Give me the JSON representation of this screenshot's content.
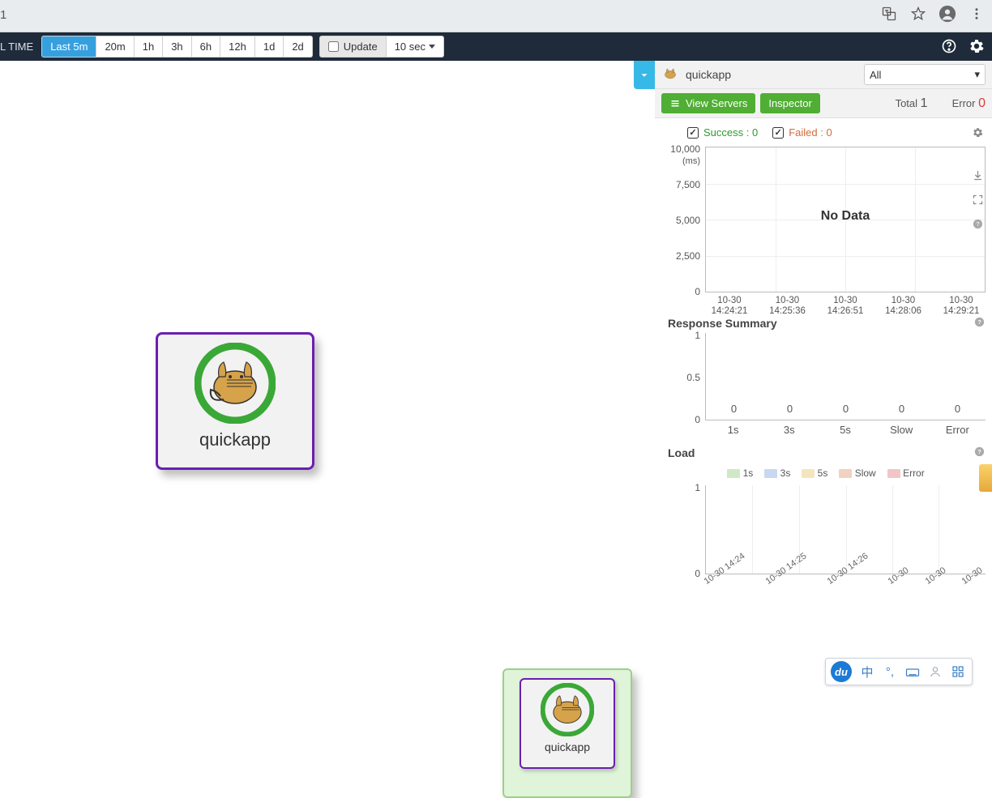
{
  "browser": {
    "url_fragment": "1"
  },
  "toolbar": {
    "realtime_label": "L TIME",
    "ranges": [
      "Last 5m",
      "20m",
      "1h",
      "3h",
      "6h",
      "12h",
      "1d",
      "2d"
    ],
    "active_range_index": 0,
    "update_label": "Update",
    "interval": "10 sec"
  },
  "canvas": {
    "main_node_label": "quickapp",
    "small_node_label": "quickapp"
  },
  "sidepanel": {
    "app_name": "quickapp",
    "selector_value": "All",
    "view_servers_label": "View Servers",
    "inspector_label": "Inspector",
    "total_label": "Total",
    "total_value": "1",
    "error_label": "Error",
    "error_value": "0",
    "legend": {
      "success_label": "Success : 0",
      "failed_label": "Failed : 0"
    }
  },
  "chart_data": [
    {
      "id": "latency",
      "type": "line",
      "title": "",
      "ylabel": "(ms)",
      "y_ticks": [
        "10,000",
        "7,500",
        "5,000",
        "2,500",
        "0"
      ],
      "x_ticks": [
        {
          "l1": "10-30",
          "l2": "14:24:21"
        },
        {
          "l1": "10-30",
          "l2": "14:25:36"
        },
        {
          "l1": "10-30",
          "l2": "14:26:51"
        },
        {
          "l1": "10-30",
          "l2": "14:28:06"
        },
        {
          "l1": "10-30",
          "l2": "14:29:21"
        }
      ],
      "no_data_label": "No Data",
      "series": []
    },
    {
      "id": "response_summary",
      "type": "bar",
      "title": "Response Summary",
      "y_ticks": [
        "1",
        "0.5",
        "0"
      ],
      "categories": [
        "1s",
        "3s",
        "5s",
        "Slow",
        "Error"
      ],
      "values": [
        0,
        0,
        0,
        0,
        0
      ]
    },
    {
      "id": "load",
      "type": "area",
      "title": "Load",
      "y_ticks": [
        "1",
        "0"
      ],
      "legend": [
        {
          "name": "1s",
          "color": "#cfe8c6"
        },
        {
          "name": "3s",
          "color": "#c9d7f2"
        },
        {
          "name": "5s",
          "color": "#f3e6be"
        },
        {
          "name": "Slow",
          "color": "#f0d2c0"
        },
        {
          "name": "Error",
          "color": "#f2c6c6"
        }
      ],
      "x_ticks": [
        "10-30 14:24",
        "10-30 14:25",
        "10-30 14:26",
        "10-30",
        "10-30",
        "10-30"
      ],
      "series": []
    }
  ],
  "ime": {
    "logo_text": "du",
    "cn_char": "中"
  }
}
